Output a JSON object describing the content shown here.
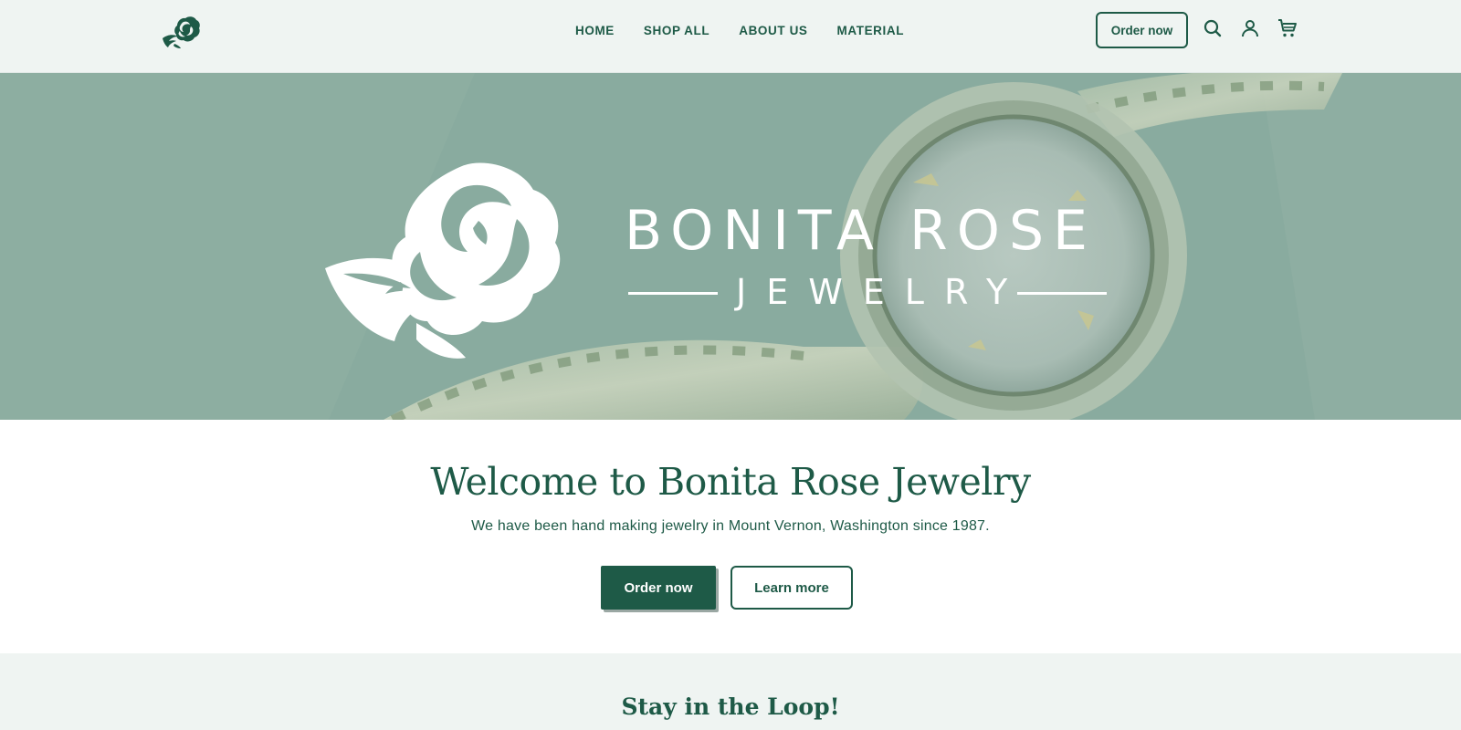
{
  "header": {
    "logo_icon": "rose-logo-icon",
    "nav": [
      {
        "label": "HOME"
      },
      {
        "label": "SHOP ALL"
      },
      {
        "label": "ABOUT US"
      },
      {
        "label": "MATERIAL"
      }
    ],
    "order_button": "Order now",
    "icons": [
      "search-icon",
      "account-icon",
      "cart-icon"
    ]
  },
  "hero": {
    "brand_title": "BONITA ROSE",
    "brand_subtitle": "JEWELRY",
    "brand_logo": "rose-logo"
  },
  "welcome": {
    "title": "Welcome to Bonita Rose Jewelry",
    "text": "We have been hand making jewelry in Mount Vernon, Washington since 1987.",
    "primary_button": "Order now",
    "secondary_button": "Learn more"
  },
  "newsletter": {
    "title": "Stay in the Loop!"
  },
  "colors": {
    "brand_green": "#1e5a47",
    "header_bg": "#eff4f2",
    "hero_overlay": "#8aac9f"
  }
}
